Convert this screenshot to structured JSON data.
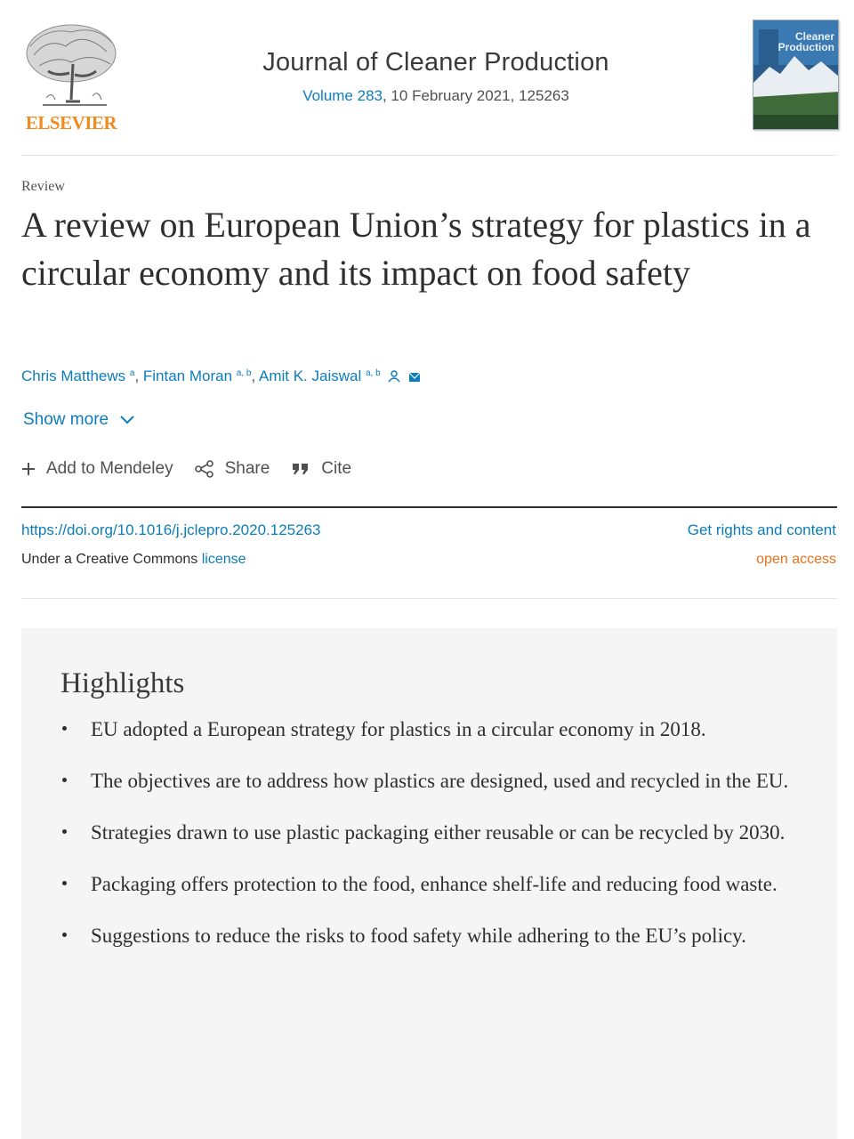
{
  "publisher": {
    "name": "ELSEVIER",
    "logo_icon": "elsevier-tree-logo"
  },
  "journal": {
    "title": "Journal of Cleaner Production",
    "volume_link": "Volume 283",
    "issue_info": ", 10 February 2021, 125263",
    "cover_title": "Cleaner Production"
  },
  "article": {
    "type": "Review",
    "title": "A review on European Union’s strategy for plastics in a circular economy and its impact on food safety"
  },
  "authors": [
    {
      "name": "Chris Matthews",
      "affiliations": "a"
    },
    {
      "name": "Fintan Moran",
      "affiliations": "a, b"
    },
    {
      "name": "Amit K. Jaiswal",
      "affiliations": "a, b"
    }
  ],
  "show_more": {
    "label": "Show more",
    "icon": "chevron-down-icon"
  },
  "actions": {
    "mendeley": "Add to Mendeley",
    "share": "Share",
    "cite": "Cite"
  },
  "doi": "https://doi.org/10.1016/j.jclepro.2020.125263",
  "license": {
    "prefix": "Under a Creative Commons ",
    "link": "license"
  },
  "rights_link": "Get rights and content",
  "access": "open access",
  "highlights": {
    "title": "Highlights",
    "items": [
      "EU adopted a European strategy for plastics in a circular economy in 2018.",
      "The objectives are to address how plastics are designed, used and recycled in the EU.",
      "Strategies drawn to use plastic packaging either reusable or can be recycled by 2030.",
      "Packaging offers protection to the food, enhance shelf-life and reducing food waste.",
      "Suggestions to reduce the risks to food safety while adhering to the EU’s policy."
    ]
  },
  "colors": {
    "link": "#0c7dbb",
    "publisher": "#f08b1d",
    "open_access": "#e9711c",
    "highlights_bg": "#f5f5f5"
  }
}
